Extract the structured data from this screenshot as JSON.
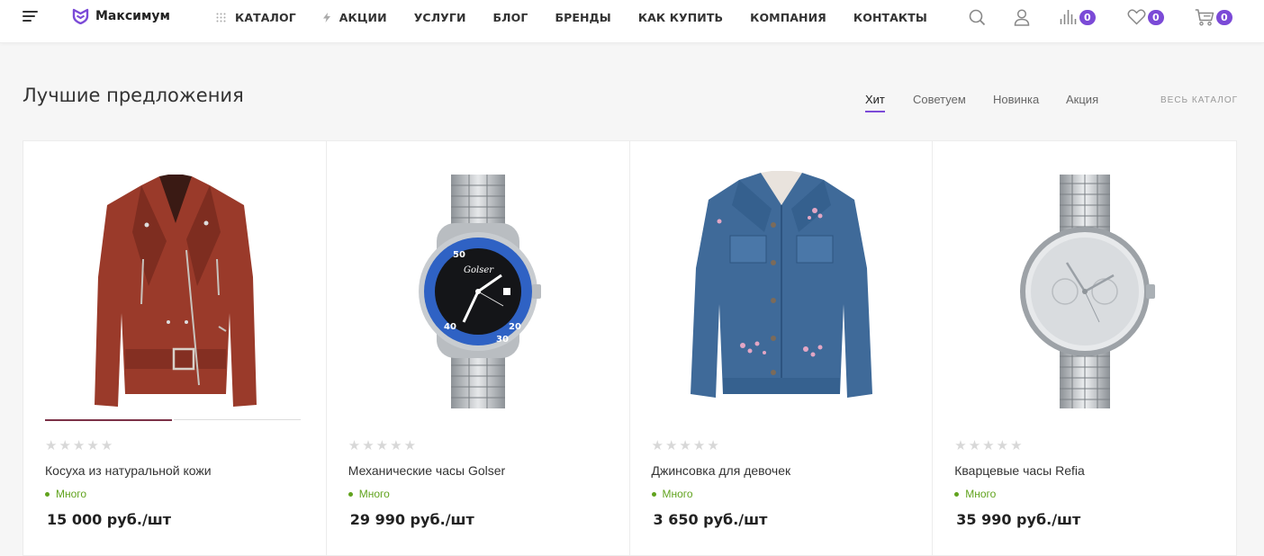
{
  "brand": {
    "name": "Максимум",
    "accent_color": "#7b4ad7"
  },
  "nav": {
    "items": [
      {
        "label": "КАТАЛОГ",
        "icon": "grid-dots-icon"
      },
      {
        "label": "АКЦИИ",
        "icon": "lightning-icon"
      },
      {
        "label": "УСЛУГИ"
      },
      {
        "label": "БЛОГ"
      },
      {
        "label": "БРЕНДЫ"
      },
      {
        "label": "КАК КУПИТЬ"
      },
      {
        "label": "КОМПАНИЯ"
      },
      {
        "label": "КОНТАКТЫ"
      }
    ]
  },
  "header_icons": {
    "search": "search-icon",
    "profile": "user-icon",
    "compare": {
      "icon": "compare-bars-icon",
      "count": "0"
    },
    "favorites": {
      "icon": "heart-icon",
      "count": "0"
    },
    "cart": {
      "icon": "cart-icon",
      "count": "0"
    }
  },
  "section": {
    "title": "Лучшие предложения",
    "tabs": [
      "Хит",
      "Советуем",
      "Новинка",
      "Акция"
    ],
    "active_tab": "Хит",
    "all_link": "ВЕСЬ КАТАЛОГ"
  },
  "products": [
    {
      "title": "Косуха из натуральной кожи",
      "stock": "Много",
      "price": "15 000 руб./шт",
      "rating": 0,
      "image": "leather-jacket-image"
    },
    {
      "title": "Механические часы Golser",
      "stock": "Много",
      "price": "29 990 руб./шт",
      "rating": 0,
      "image": "diver-watch-image"
    },
    {
      "title": "Джинсовка для девочек",
      "stock": "Много",
      "price": "3 650 руб./шт",
      "rating": 0,
      "image": "denim-jacket-image"
    },
    {
      "title": "Кварцевые часы Refia",
      "stock": "Много",
      "price": "35 990 руб./шт",
      "rating": 0,
      "image": "steel-watch-image"
    }
  ],
  "watch_brand": "Golser"
}
